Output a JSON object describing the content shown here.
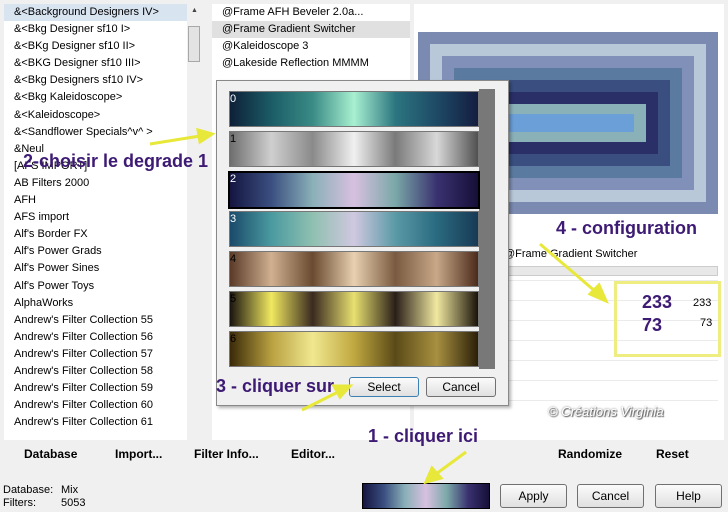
{
  "categories": [
    "&<Background Designers IV>",
    "&<Bkg Designer sf10 I>",
    "&<BKg Designer sf10 II>",
    "&<BKG Designer sf10 III>",
    "&<Bkg Designers sf10 IV>",
    "&<Bkg Kaleidoscope>",
    "&<Kaleidoscope>",
    "&<Sandflower Specials^v^ >",
    "&Neul",
    "[AFS IMPORT]",
    "AB Filters 2000",
    "AFH",
    "AFS import",
    "Alf's Border FX",
    "Alf's Power Grads",
    "Alf's Power Sines",
    "Alf's Power Toys",
    "AlphaWorks",
    "Andrew's Filter Collection 55",
    "Andrew's Filter Collection 56",
    "Andrew's Filter Collection 57",
    "Andrew's Filter Collection 58",
    "Andrew's Filter Collection 59",
    "Andrew's Filter Collection 60",
    "Andrew's Filter Collection 61"
  ],
  "filters": [
    "@Frame AFH Beveler 2.0a...",
    "@Frame Gradient Switcher",
    "@Kaleidoscope 3",
    "@Lakeside Reflection MMMM"
  ],
  "selected_filter_name": "@Frame Gradient Switcher",
  "params": {
    "value1": "233",
    "value2": "73"
  },
  "gradients": [
    {
      "index": "0",
      "stops": [
        "#0e2038",
        "#1b5c66",
        "#3a8b86",
        "#a8f0d0",
        "#2c7580",
        "#1e4a66",
        "#141d40"
      ]
    },
    {
      "index": "1",
      "stops": [
        "#6e6e6e",
        "#cfcfcf",
        "#8a8a8a",
        "#f0f0f0",
        "#7a7a7a",
        "#d8d8d8",
        "#505050"
      ]
    },
    {
      "index": "2",
      "stops": [
        "#151540",
        "#3a4f80",
        "#8ab0b8",
        "#d8c0e0",
        "#7aa8a8",
        "#3a3270",
        "#150f38"
      ]
    },
    {
      "index": "3",
      "stops": [
        "#1a4a6a",
        "#4a9aa0",
        "#8fc0b0",
        "#d0c8e0",
        "#5a9aa6",
        "#2a6a80",
        "#183a55"
      ]
    },
    {
      "index": "4",
      "stops": [
        "#5a3a28",
        "#d0b090",
        "#6a4a30",
        "#e8d0b0",
        "#7a5a40",
        "#c8a888",
        "#4a2a1a"
      ]
    },
    {
      "index": "5",
      "stops": [
        "#1a1410",
        "#f0e860",
        "#3a2a20",
        "#e8e070",
        "#2a1f18",
        "#f0e8a0",
        "#1a1208"
      ]
    },
    {
      "index": "6",
      "stops": [
        "#3a2a08",
        "#b8a040",
        "#f0e890",
        "#c0a840",
        "#5a4a18",
        "#a89040",
        "#2a1f08"
      ]
    }
  ],
  "dialog": {
    "select_label": "Select",
    "cancel_label": "Cancel"
  },
  "toolbar": {
    "database": "Database",
    "import": "Import...",
    "filter_info": "Filter Info...",
    "editor": "Editor...",
    "randomize": "Randomize",
    "reset": "Reset"
  },
  "status": {
    "database_label": "Database:",
    "database_value": "Mix",
    "filters_label": "Filters:",
    "filters_value": "5053"
  },
  "actions": {
    "apply": "Apply",
    "cancel": "Cancel",
    "help": "Help"
  },
  "annotations": {
    "step1": "1 - cliquer ici",
    "step2": "2-choisir le degrade 1",
    "step3": "3 - cliquer sur",
    "step4": "4 - configuration",
    "watermark": "© Créations Virginia"
  },
  "colors": {
    "annotation": "#3d1a73",
    "highlight": "#eeee80",
    "arrow": "#e8e83a"
  }
}
